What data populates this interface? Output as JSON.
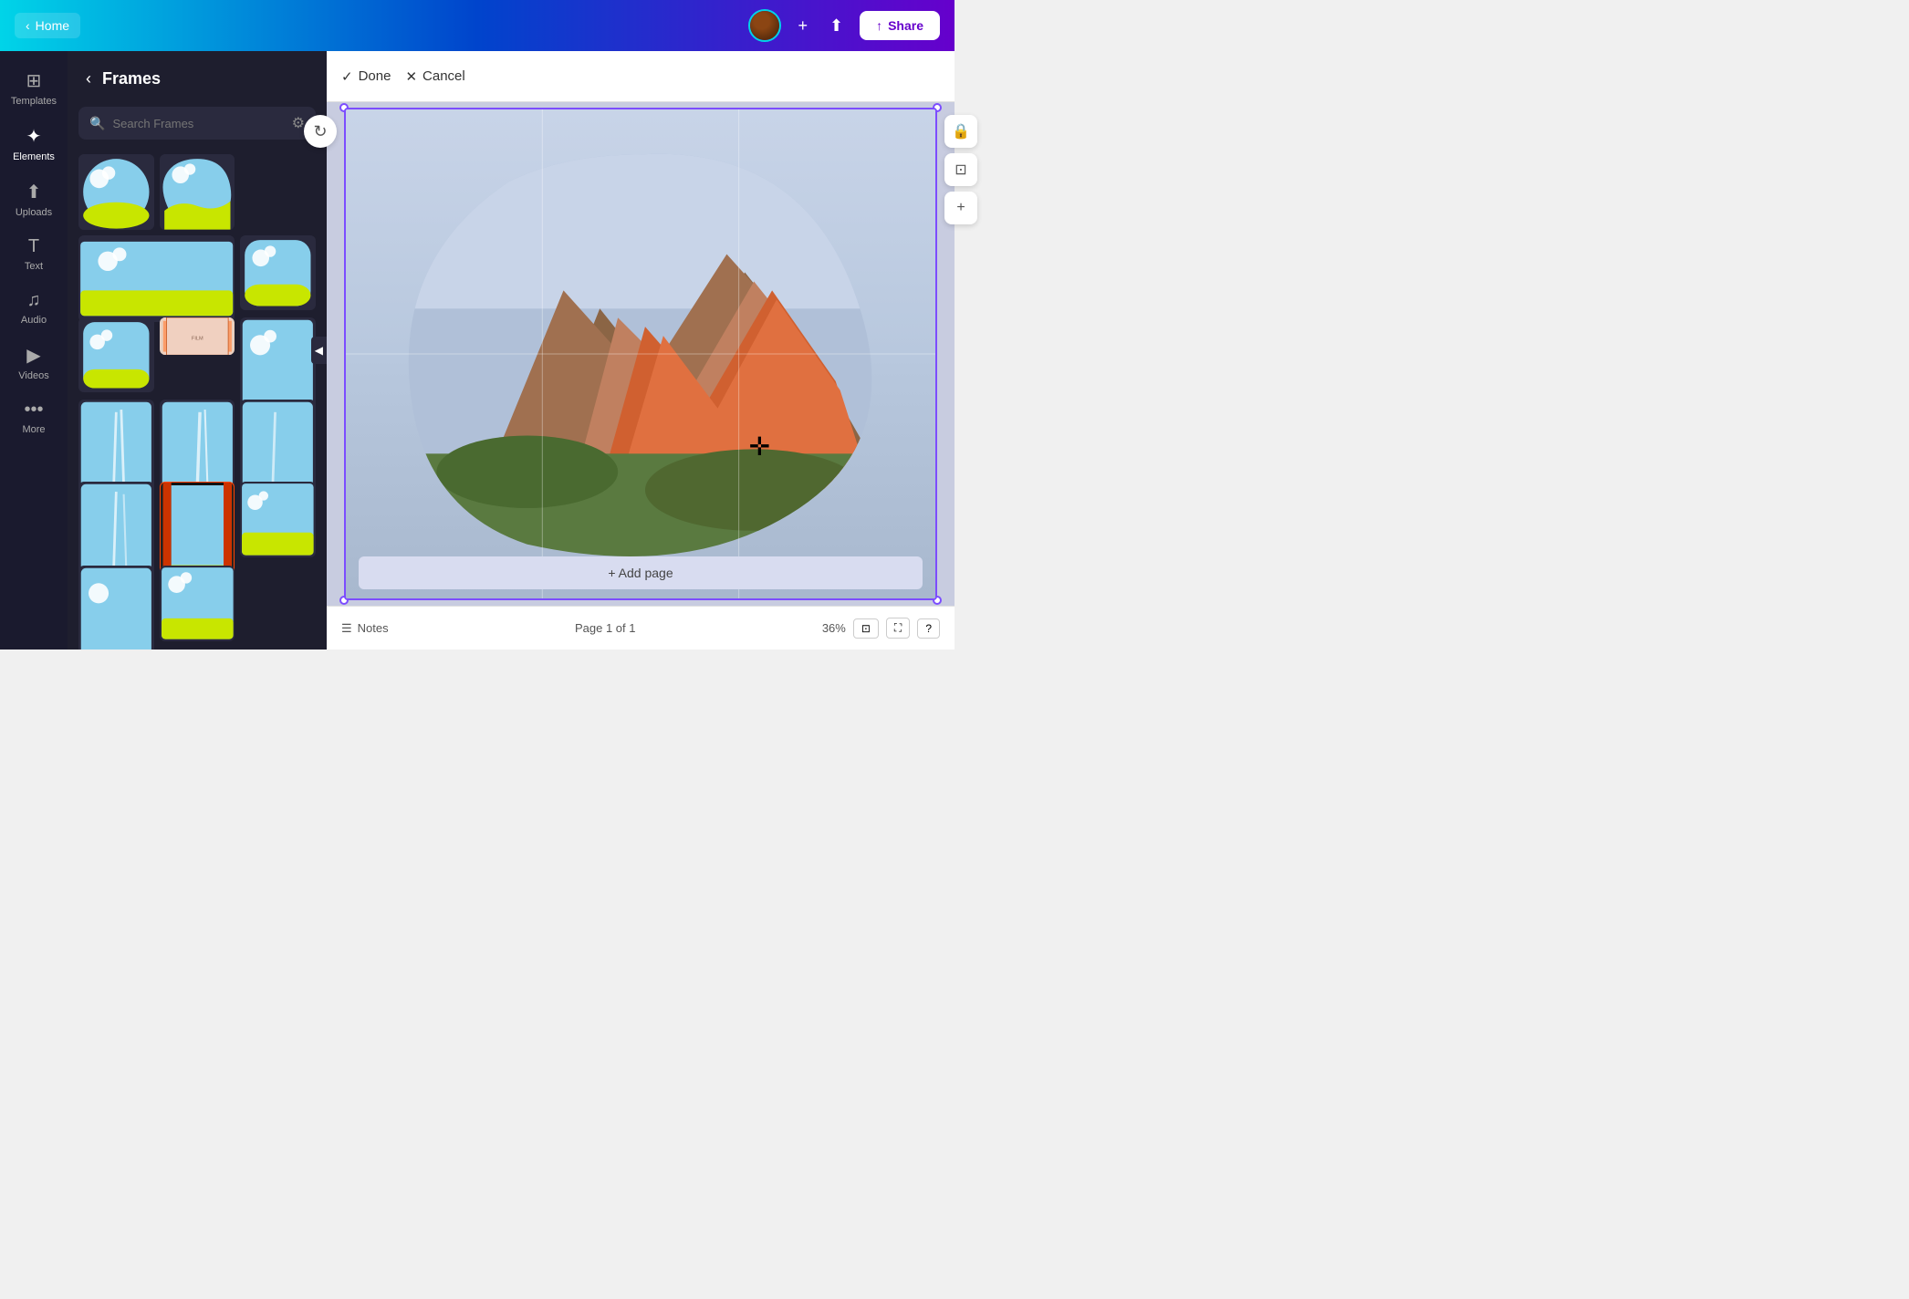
{
  "topbar": {
    "home_label": "Home",
    "share_label": "Share",
    "plus_icon": "+",
    "chart_icon": "📊"
  },
  "frames_panel": {
    "back_label": "‹",
    "title": "Frames",
    "search_placeholder": "Search Frames",
    "filter_icon": "⚙"
  },
  "sidebar": {
    "items": [
      {
        "id": "templates",
        "label": "Templates",
        "icon": "⊞"
      },
      {
        "id": "elements",
        "label": "Elements",
        "icon": "✦"
      },
      {
        "id": "uploads",
        "label": "Uploads",
        "icon": "⬆"
      },
      {
        "id": "text",
        "label": "Text",
        "icon": "T"
      },
      {
        "id": "audio",
        "label": "Audio",
        "icon": "♪"
      },
      {
        "id": "videos",
        "label": "Videos",
        "icon": "▶"
      },
      {
        "id": "more",
        "label": "More",
        "icon": "···"
      }
    ]
  },
  "canvas_toolbar": {
    "done_label": "Done",
    "cancel_label": "Cancel",
    "check_icon": "✓",
    "x_icon": "✕"
  },
  "canvas": {
    "add_page_label": "+ Add page",
    "refresh_icon": "↻"
  },
  "bottom_bar": {
    "notes_icon": "☰",
    "notes_label": "Notes",
    "page_info": "Page 1 of 1",
    "zoom_label": "36%",
    "pages_icon": "⊡",
    "expand_icon": "⛶",
    "help_icon": "?"
  }
}
